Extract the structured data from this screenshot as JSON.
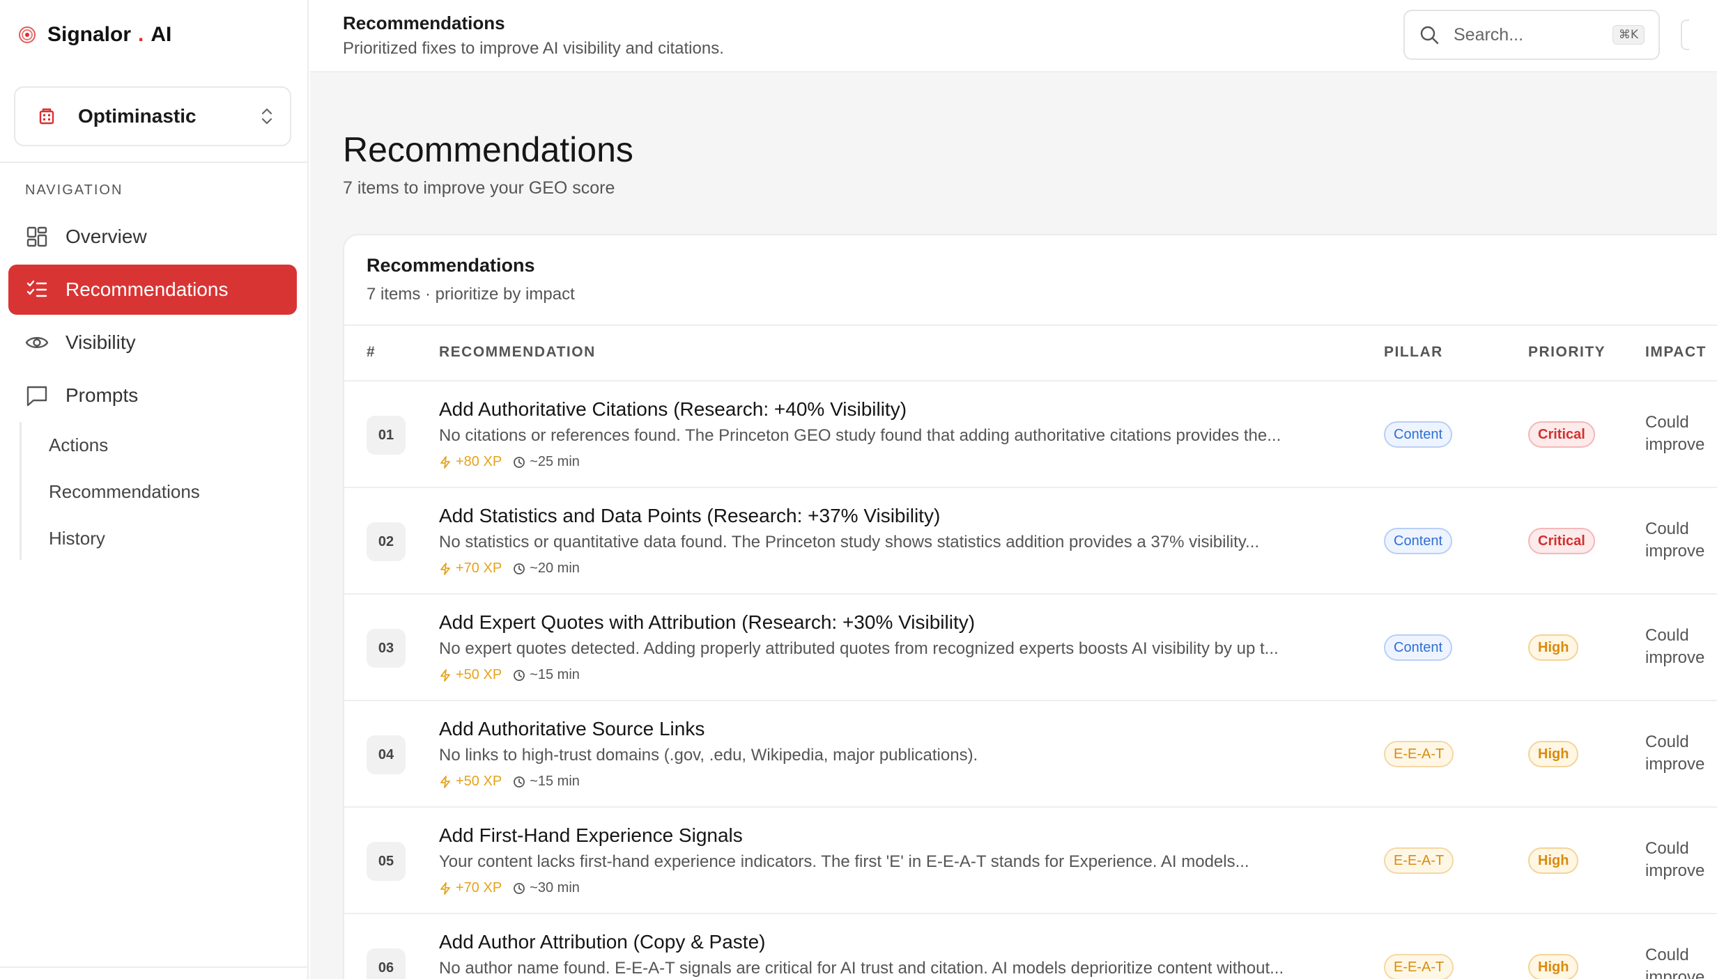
{
  "brand": {
    "name": "Signalor",
    "dot": ".",
    "suffix": "AI",
    "accent": "#dc2f2f"
  },
  "workspace": {
    "name": "Optiminastic"
  },
  "navigation": {
    "title": "NAVIGATION",
    "items": [
      {
        "label": "Overview",
        "icon": "grid-icon"
      },
      {
        "label": "Recommendations",
        "icon": "checklist-icon",
        "active": true
      },
      {
        "label": "Visibility",
        "icon": "eye-icon"
      },
      {
        "label": "Prompts",
        "icon": "message-icon"
      }
    ],
    "subitems": [
      "Actions",
      "Recommendations",
      "History"
    ]
  },
  "header": {
    "title": "Recommendations",
    "subtitle": "Prioritized fixes to improve AI visibility and citations.",
    "search_placeholder": "Search...",
    "shortcut": "⌘K"
  },
  "page": {
    "title": "Recommendations",
    "subtitle": "7 items to improve your GEO score"
  },
  "table": {
    "title": "Recommendations",
    "subtitle": "7 items · prioritize by impact",
    "columns": [
      "#",
      "RECOMMENDATION",
      "PILLAR",
      "PRIORITY",
      "IMPACT"
    ],
    "rows": [
      {
        "num": "01",
        "title": "Add Authoritative Citations (Research: +40% Visibility)",
        "desc": "No citations or references found. The Princeton GEO study found that adding authoritative citations provides the...",
        "xp": "+80 XP",
        "time": "~25 min",
        "pillar": "Content",
        "priority": "Critical",
        "impact_1": "Could",
        "impact_2": "improve"
      },
      {
        "num": "02",
        "title": "Add Statistics and Data Points (Research: +37% Visibility)",
        "desc": "No statistics or quantitative data found. The Princeton study shows statistics addition provides a 37% visibility...",
        "xp": "+70 XP",
        "time": "~20 min",
        "pillar": "Content",
        "priority": "Critical",
        "impact_1": "Could",
        "impact_2": "improve"
      },
      {
        "num": "03",
        "title": "Add Expert Quotes with Attribution (Research: +30% Visibility)",
        "desc": "No expert quotes detected. Adding properly attributed quotes from recognized experts boosts AI visibility by up t...",
        "xp": "+50 XP",
        "time": "~15 min",
        "pillar": "Content",
        "priority": "High",
        "impact_1": "Could",
        "impact_2": "improve"
      },
      {
        "num": "04",
        "title": "Add Authoritative Source Links",
        "desc": "No links to high-trust domains (.gov, .edu, Wikipedia, major publications).",
        "xp": "+50 XP",
        "time": "~15 min",
        "pillar": "E-E-A-T",
        "priority": "High",
        "impact_1": "Could",
        "impact_2": "improve"
      },
      {
        "num": "05",
        "title": "Add First-Hand Experience Signals",
        "desc": "Your content lacks first-hand experience indicators. The first 'E' in E-E-A-T stands for Experience. AI models...",
        "xp": "+70 XP",
        "time": "~30 min",
        "pillar": "E-E-A-T",
        "priority": "High",
        "impact_1": "Could",
        "impact_2": "improve"
      },
      {
        "num": "06",
        "title": "Add Author Attribution (Copy & Paste)",
        "desc": "No author name found. E-E-A-T signals are critical for AI trust and citation. AI models deprioritize content without...",
        "xp": "",
        "time": "",
        "pillar": "E-E-A-T",
        "priority": "High",
        "impact_1": "Could",
        "impact_2": "improve"
      }
    ]
  }
}
